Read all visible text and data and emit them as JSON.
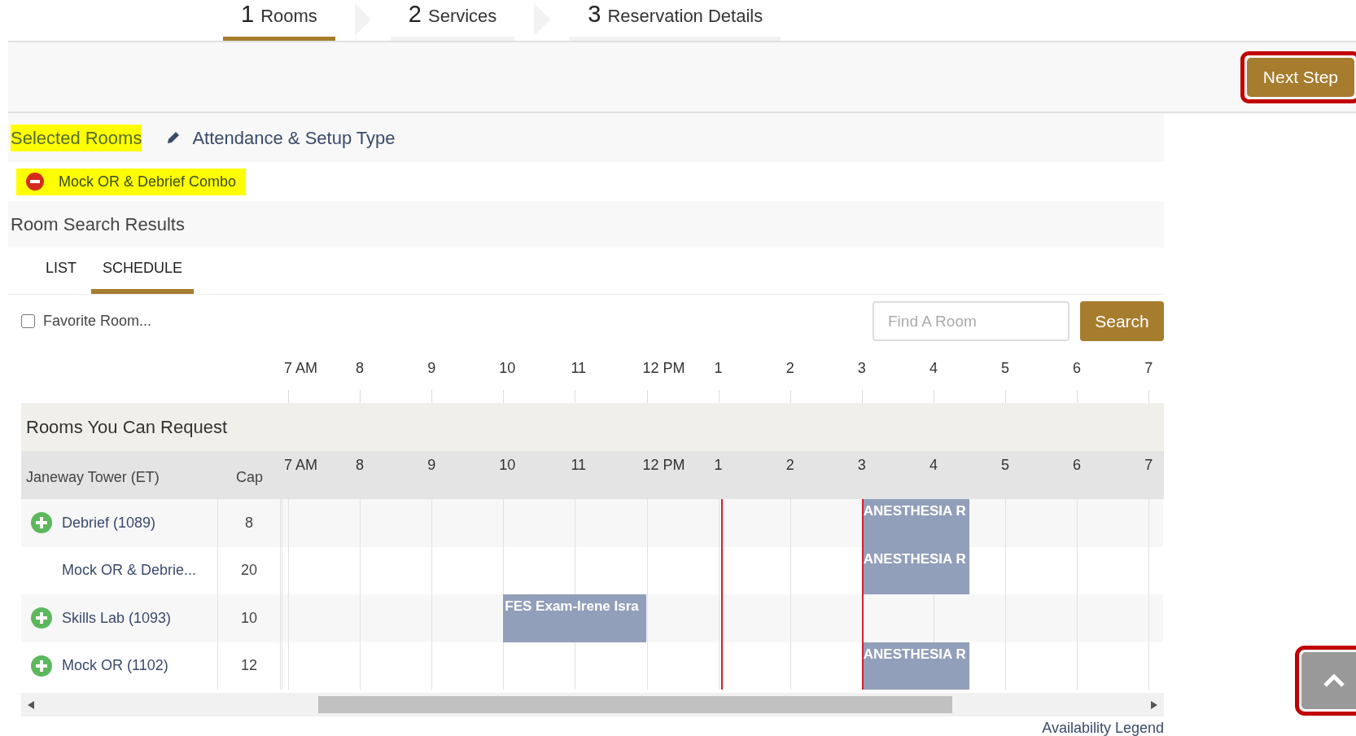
{
  "steps": [
    {
      "number": "1",
      "label": "Rooms",
      "selected": true
    },
    {
      "number": "2",
      "label": "Services",
      "selected": false
    },
    {
      "number": "3",
      "label": "Reservation Details",
      "selected": false
    }
  ],
  "toolbar": {
    "next_button": {
      "label": "Next Step",
      "outlined": true
    }
  },
  "selected_rooms": {
    "title": "Selected Rooms",
    "title_highlighted": true,
    "edit_link": "Attendance & Setup Type",
    "items": [
      {
        "name": "Mock OR & Debrief Combo",
        "highlighted": true
      }
    ]
  },
  "results": {
    "title": "Room Search Results",
    "view_tabs": [
      {
        "label": "LIST",
        "selected": false
      },
      {
        "label": "SCHEDULE",
        "selected": true
      }
    ],
    "favorite": {
      "label": "Favorite Room...",
      "checked": false
    },
    "search": {
      "placeholder": "Find A Room",
      "button": "Search"
    },
    "axis_labels": [
      "7 AM",
      "8",
      "9",
      "10",
      "11",
      "12 PM",
      "1",
      "2",
      "3",
      "4",
      "5",
      "6",
      "7"
    ],
    "group_title": "Rooms You Can Request",
    "header": {
      "building": "Janeway Tower (ET)",
      "cap": "Cap",
      "time_labels": [
        "7 AM",
        "8",
        "9",
        "10",
        "11",
        "12 PM",
        "1",
        "2",
        "3",
        "4",
        "5",
        "6",
        "7"
      ]
    },
    "rows": [
      {
        "name": "Debrief (1089)",
        "cap": "8",
        "can_add": true,
        "bookings": [
          {
            "label": "ANESTHESIA R"
          }
        ]
      },
      {
        "name": "Mock OR & Debrie...",
        "cap": "20",
        "can_add": false,
        "bookings": [
          {
            "label": "ANESTHESIA R"
          }
        ]
      },
      {
        "name": "Skills Lab (1093)",
        "cap": "10",
        "can_add": true,
        "bookings": [
          {
            "label": "FES Exam-Irene Isra"
          }
        ]
      },
      {
        "name": "Mock OR (1102)",
        "cap": "12",
        "can_add": true,
        "bookings": [
          {
            "label": "ANESTHESIA R"
          }
        ]
      }
    ],
    "legend_link": "Availability Legend"
  },
  "scroll_top": {
    "outlined": true
  }
}
